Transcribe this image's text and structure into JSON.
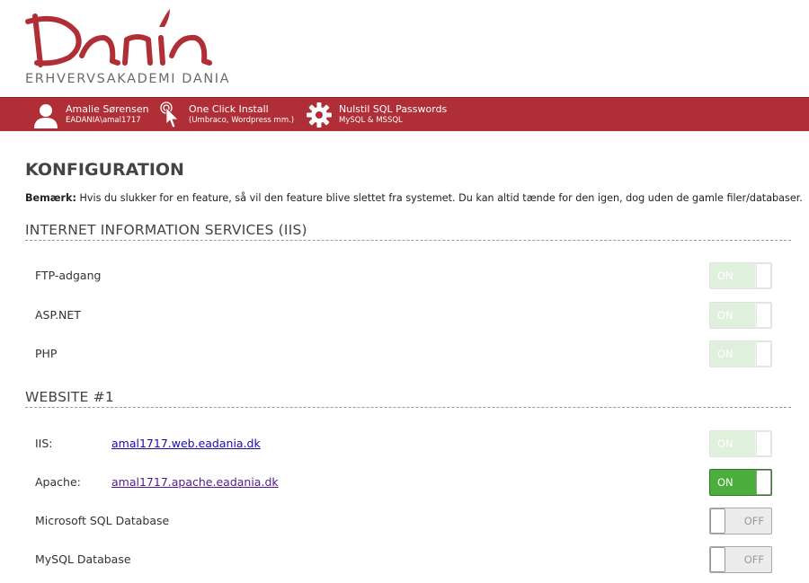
{
  "brand": {
    "logo_text": "Dania",
    "subtitle": "ERHVERVSAKADEMI DANIA",
    "color": "#b02f37"
  },
  "nav": [
    {
      "icon": "user-icon",
      "title": "Amalie Sørensen",
      "sub": "EADANIA\\amal1717"
    },
    {
      "icon": "pointer-click-icon",
      "title": "One Click Install",
      "sub": "(Umbraco, Wordpress mm.)"
    },
    {
      "icon": "gear-icon",
      "title": "Nulstil SQL Passwords",
      "sub": "MySQL & MSSQL"
    }
  ],
  "page": {
    "title": "KONFIGURATION",
    "note_bold": "Bemærk:",
    "note_text": " Hvis du slukker for en feature, så vil den feature blive slettet fra systemet. Du kan altid tænde for den igen, dog uden de gamle filer/databaser."
  },
  "sections": [
    {
      "title": "INTERNET INFORMATION SERVICES (IIS)",
      "rows": [
        {
          "label": "FTP-adgang",
          "state": "on-disabled",
          "state_text": "ON"
        },
        {
          "label": "ASP.NET",
          "state": "on-disabled",
          "state_text": "ON"
        },
        {
          "label": "PHP",
          "state": "on-disabled",
          "state_text": "ON"
        }
      ]
    },
    {
      "title": "WEBSITE #1",
      "rows": [
        {
          "label": "IIS:",
          "link": "amal1717.web.eadania.dk",
          "state": "on-disabled",
          "state_text": "ON"
        },
        {
          "label": "Apache:",
          "link": "amal1717.apache.eadania.dk",
          "state": "on",
          "state_text": "ON"
        },
        {
          "label": "Microsoft SQL Database",
          "state": "off",
          "state_text": "OFF"
        },
        {
          "label": "MySQL Database",
          "state": "off",
          "state_text": "OFF"
        }
      ]
    }
  ]
}
